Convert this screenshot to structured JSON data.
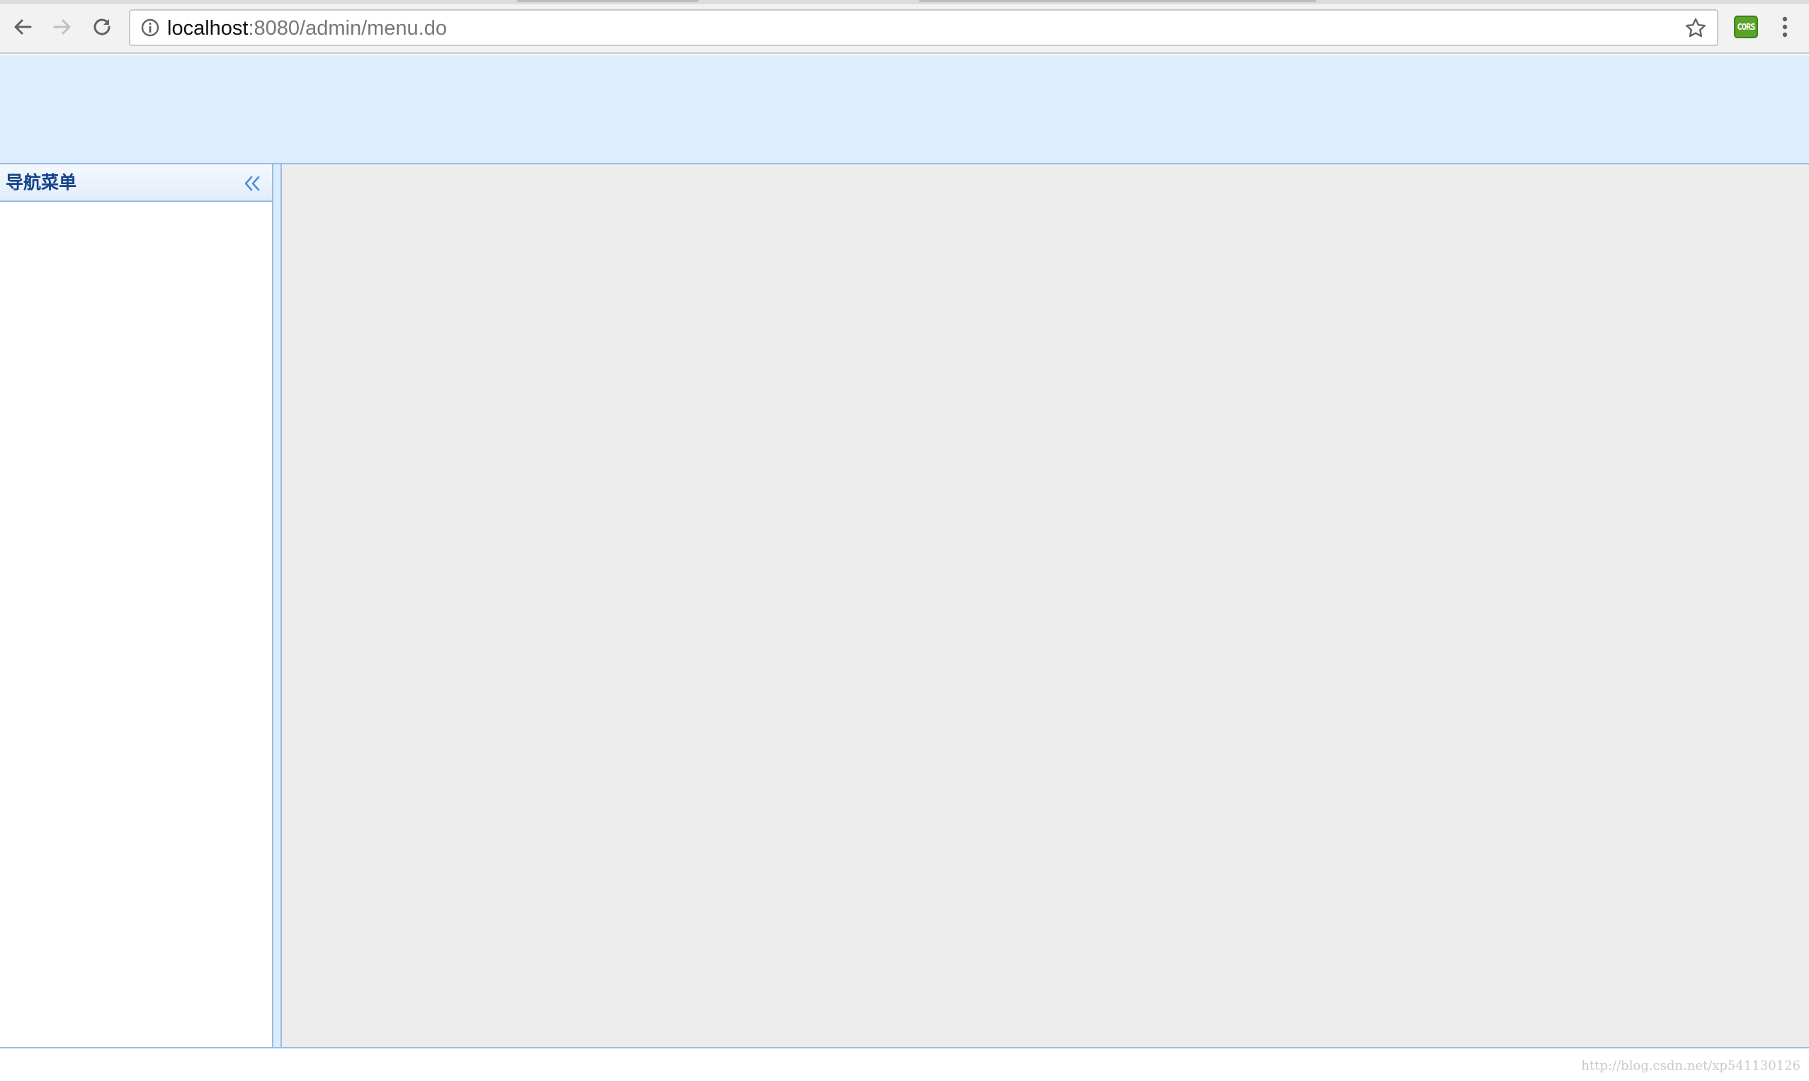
{
  "browser": {
    "url_host": "localhost",
    "url_rest": ":8080/admin/menu.do",
    "extension_label": "CORS"
  },
  "west_panel": {
    "title": "导航菜单"
  },
  "watermark": "http://blog.csdn.net/xp541130126",
  "colors": {
    "banner_bg": "#deedfe",
    "panel_border": "#99bbe8",
    "panel_title": "#15428b",
    "center_bg": "#ededed",
    "extension_green": "#5aa32a"
  },
  "icons": {
    "back": "back-arrow-icon",
    "forward": "forward-arrow-icon",
    "reload": "reload-icon",
    "info": "info-icon",
    "bookmark": "star-icon",
    "extension": "cors-extension-icon",
    "menu": "kebab-menu-icon",
    "collapse": "double-chevron-left-icon"
  }
}
